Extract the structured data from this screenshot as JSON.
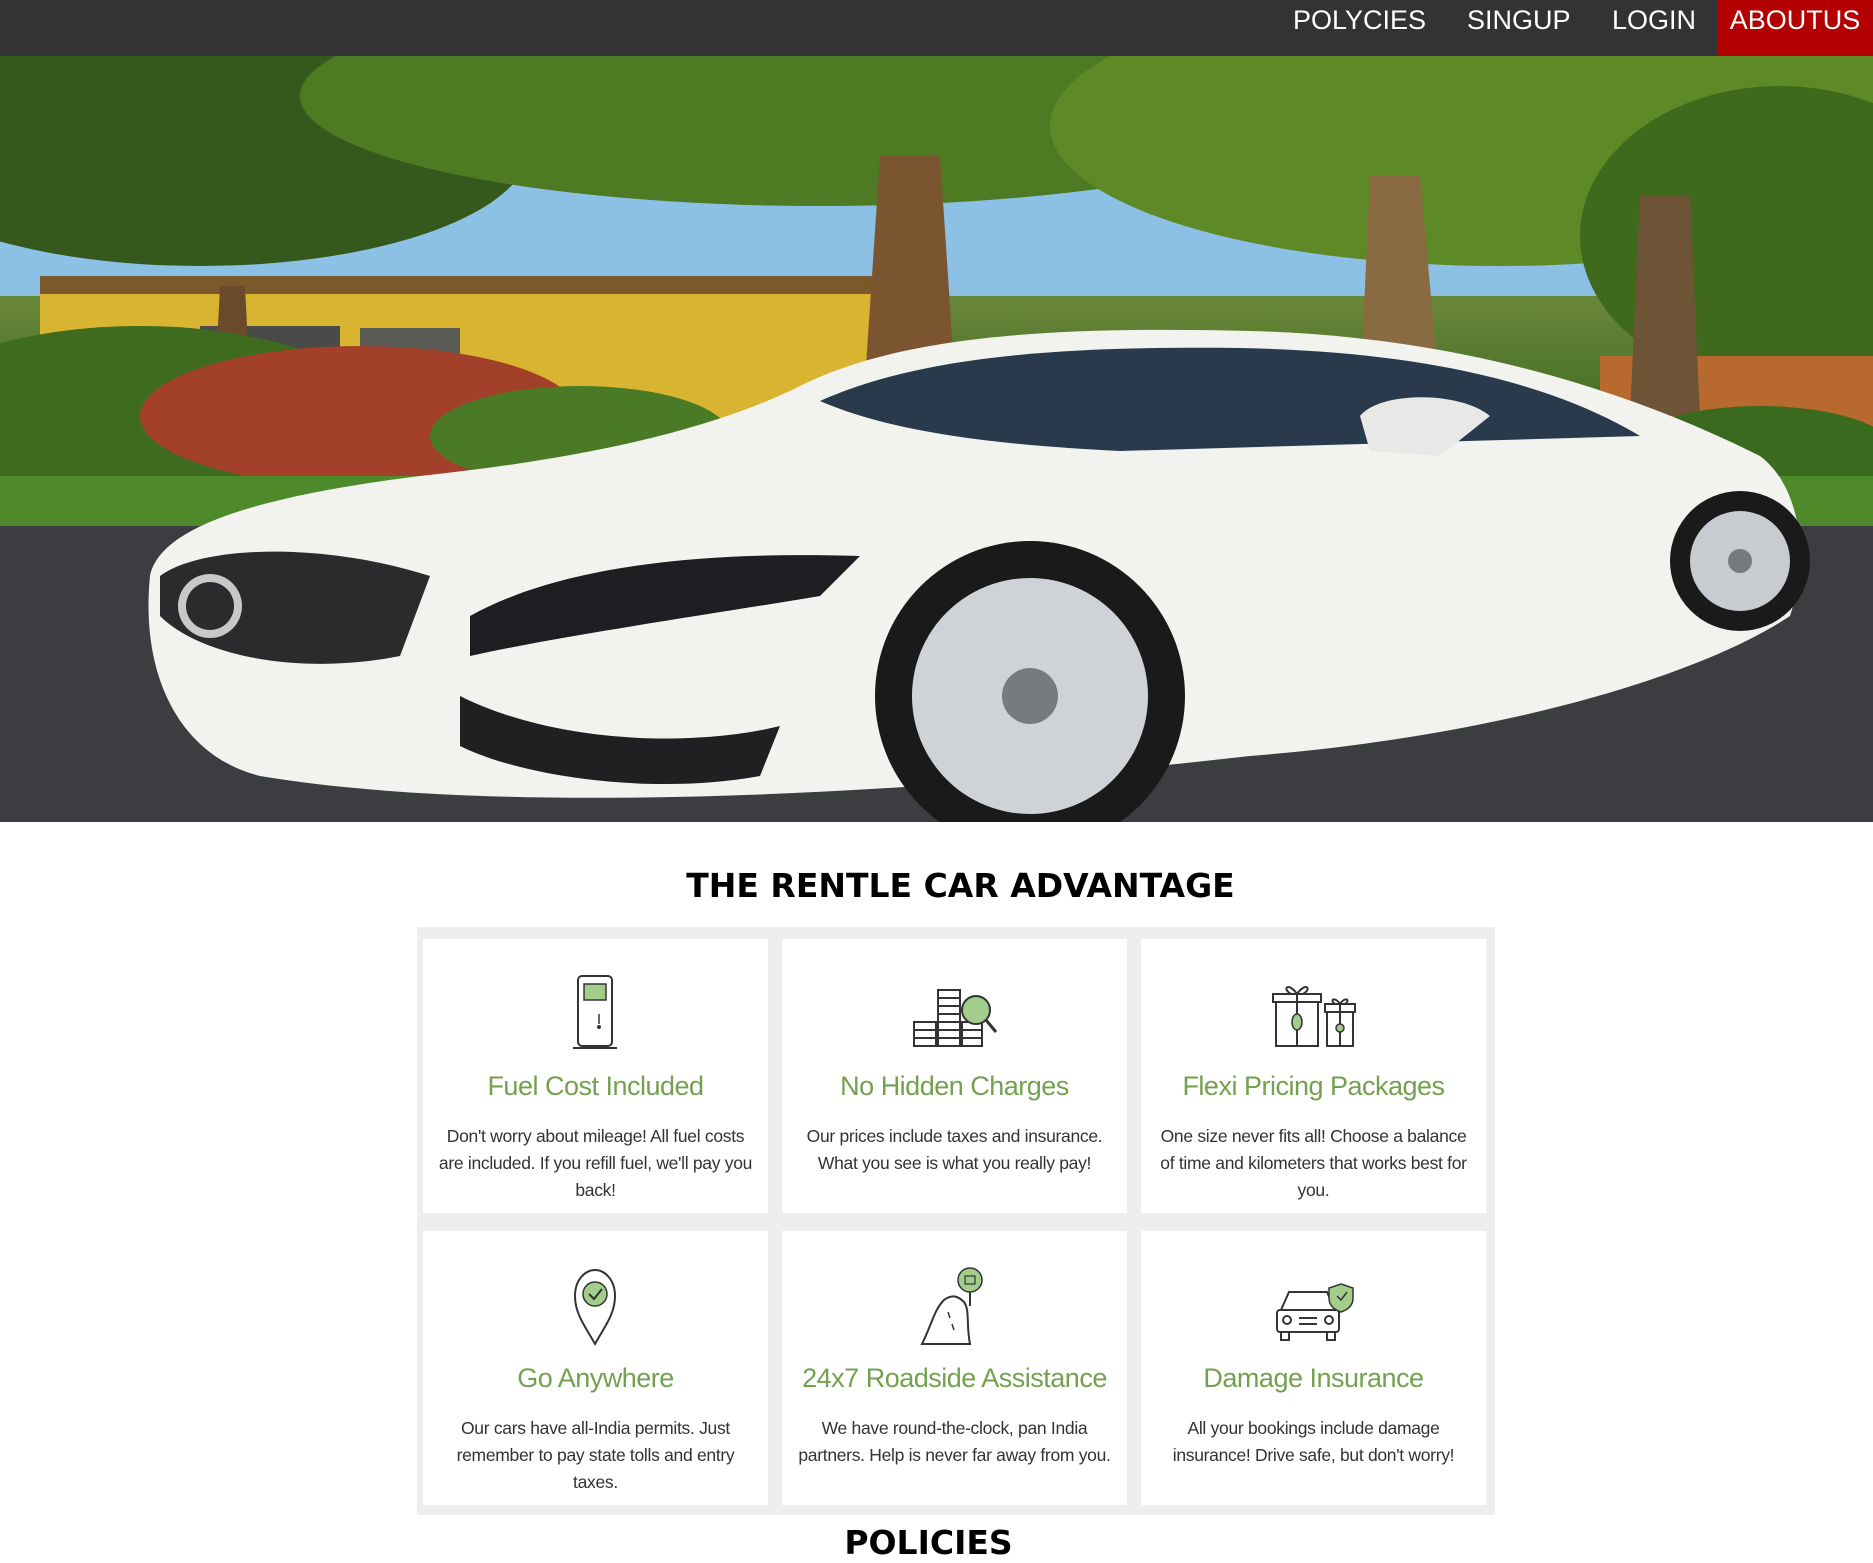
{
  "nav": {
    "items": [
      {
        "label": "POLYCIES"
      },
      {
        "label": "SINGUP"
      },
      {
        "label": "LOGIN"
      },
      {
        "label": "ABOUTUS"
      }
    ],
    "active": "ABOUTUS",
    "active_color": "#b30000",
    "bar_color": "#333333"
  },
  "hero": {
    "image": "white luxury sedan parked under palm trees in front of a yellow house"
  },
  "advantage": {
    "title": "THE RENTLE CAR ADVANTAGE",
    "accent_color": "#73a14f",
    "cards": [
      {
        "icon": "fuel-pump-icon",
        "title": "Fuel Cost Included",
        "text": "Don't worry about mileage! All fuel costs are included. If you refill fuel, we'll pay you back!"
      },
      {
        "icon": "coins-magnifier-icon",
        "title": "No Hidden Charges",
        "text": "Our prices include taxes and insurance. What you see is what you really pay!"
      },
      {
        "icon": "gift-boxes-icon",
        "title": "Flexi Pricing Packages",
        "text": "One size never fits all! Choose a balance of time and kilometers that works best for you."
      },
      {
        "icon": "location-pin-icon",
        "title": "Go Anywhere",
        "text": "Our cars have all-India permits. Just remember to pay state tolls and entry taxes."
      },
      {
        "icon": "road-assistance-icon",
        "title": "24x7 Roadside Assistance",
        "text": "We have round-the-clock, pan India partners. Help is never far away from you."
      },
      {
        "icon": "car-shield-icon",
        "title": "Damage Insurance",
        "text": "All your bookings include damage insurance! Drive safe, but don't worry!"
      }
    ]
  },
  "policies": {
    "title": "POLICIES"
  }
}
